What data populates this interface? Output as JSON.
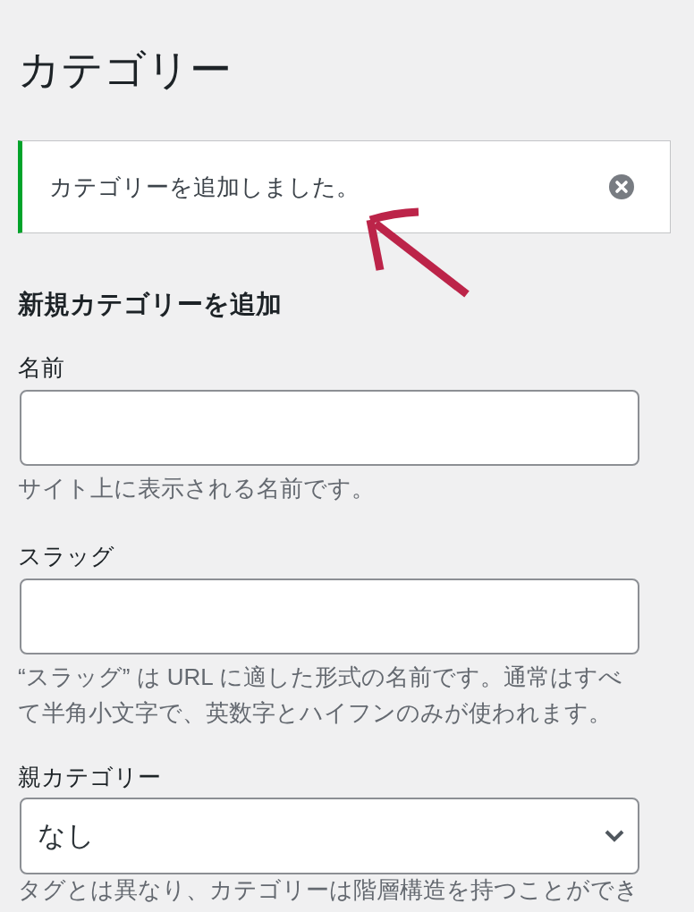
{
  "page": {
    "title": "カテゴリー"
  },
  "notice": {
    "kind": "success",
    "message": "カテゴリーを追加しました。",
    "dismissible": true
  },
  "annotation": {
    "kind": "arrow"
  },
  "form": {
    "heading": "新規カテゴリーを追加",
    "fields": [
      {
        "kind": "text",
        "label": "名前",
        "description": "サイト上に表示される名前です。"
      },
      {
        "kind": "text",
        "label": "スラッグ",
        "description": "“スラッグ” は URL に適した形式の名前です。通常はすべて半角小文字で、英数字とハイフンのみが使われます。"
      },
      {
        "kind": "select",
        "label": "親カテゴリー",
        "value": "なし",
        "description": "タグとは異なり、カテゴリーは階層構造を持つことができ"
      }
    ]
  }
}
